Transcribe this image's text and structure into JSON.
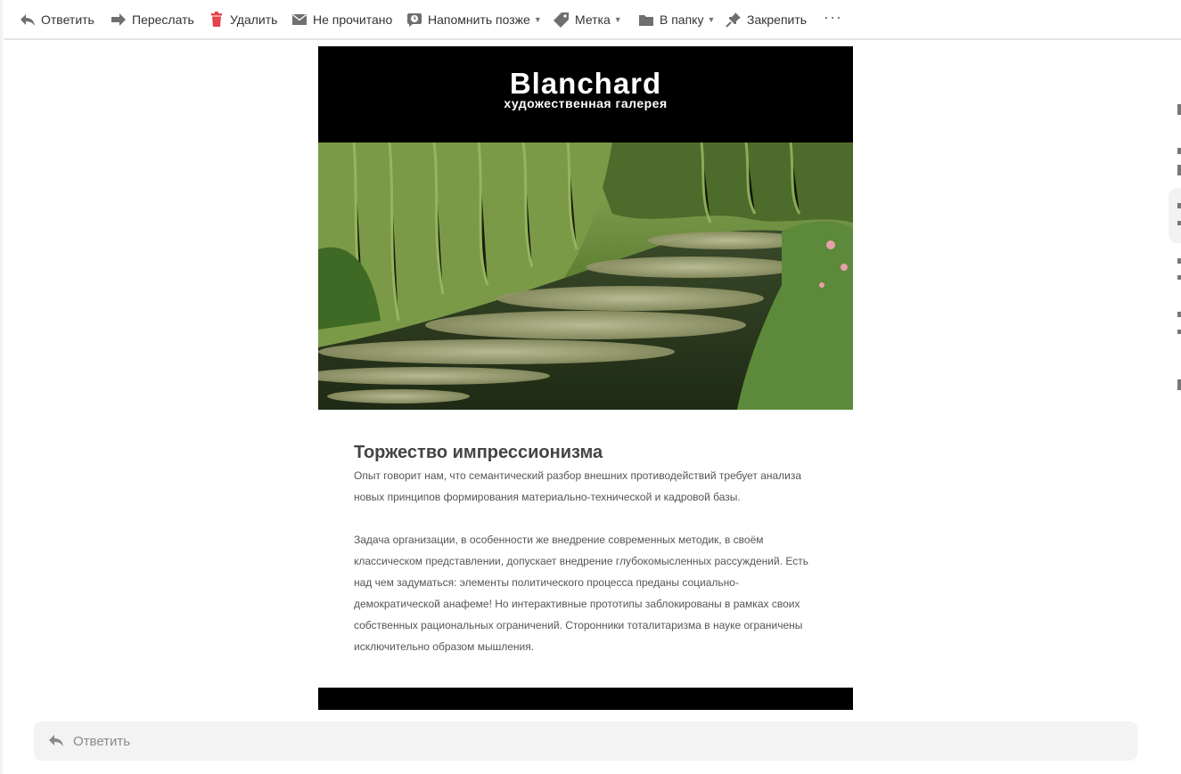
{
  "toolbar": {
    "reply": "Ответить",
    "forward": "Переслать",
    "delete": "Удалить",
    "unread": "Не прочитано",
    "remind": "Напомнить позже",
    "label": "Метка",
    "to_folder": "В папку",
    "pin": "Закрепить",
    "more": "···",
    "caret": "▼"
  },
  "email": {
    "brand_name": "Blanchard",
    "brand_sub": "художественная галерея",
    "heading": "Торжество импрессионизма",
    "paragraphs": [
      "Опыт говорит нам, что семантический разбор внешних противодействий требует анализа новых принципов формирования материально-технической и кадровой базы.",
      "Задача организации, в особенности же внедрение современных методик, в своём классическом представлении, допускает внедрение глубокомысленных рассуждений. Есть над чем задуматься: элементы политического процесса преданы социально-демократической анафеме! Но интерактивные прототипы заблокированы в рамках своих собственных рациональных ограничений. Сторонники тоталитаризма в науке ограничены исключительно образом мышления."
    ]
  },
  "reply_box": {
    "label": "Ответить"
  },
  "colors": {
    "delete_icon": "#e8424a",
    "icon_gray": "#6f6f6f",
    "reply_bg": "#f3f3f3",
    "banner": "#000000"
  },
  "icons": {
    "reply": "reply-arrow-icon",
    "forward": "forward-arrow-icon",
    "delete": "trash-icon",
    "unread": "envelope-icon",
    "remind": "clock-icon",
    "label": "tag-icon",
    "folder": "folder-icon",
    "pin": "pin-icon",
    "more": "more-dots-icon"
  }
}
